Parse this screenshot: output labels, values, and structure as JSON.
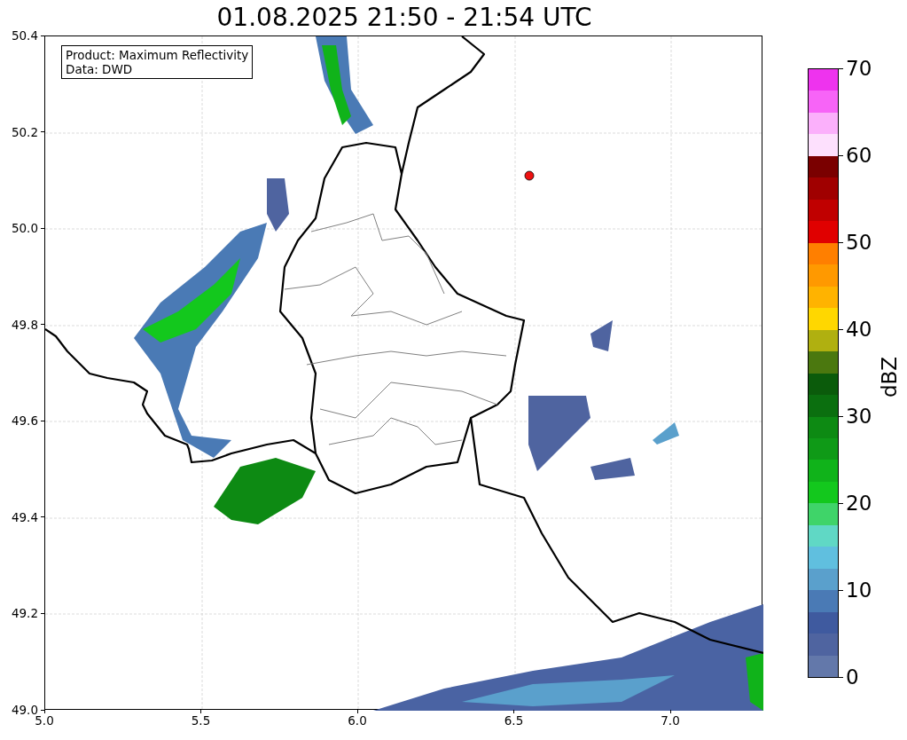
{
  "title": "01.08.2025 21:50 - 21:54 UTC",
  "info_box": [
    "Product: Maximum Reflectivity",
    "Data: DWD"
  ],
  "x_ticks": [
    "5.0",
    "5.5",
    "6.0",
    "6.5",
    "7.0"
  ],
  "y_ticks": [
    "50.4",
    "50.2",
    "50.0",
    "49.8",
    "49.6",
    "49.4",
    "49.2",
    "49.0"
  ],
  "colorbar": {
    "label": "dBZ",
    "ticks": [
      "70",
      "60",
      "50",
      "40",
      "30",
      "20",
      "10",
      "0"
    ],
    "bands": [
      {
        "color": "#ee33ee"
      },
      {
        "color": "#f764f7"
      },
      {
        "color": "#fbb0fb"
      },
      {
        "color": "#fde0fd"
      },
      {
        "color": "#7a0000"
      },
      {
        "color": "#a00000"
      },
      {
        "color": "#c00000"
      },
      {
        "color": "#e00000"
      },
      {
        "color": "#ff7f00"
      },
      {
        "color": "#ff9900"
      },
      {
        "color": "#ffb300"
      },
      {
        "color": "#ffd700"
      },
      {
        "color": "#b0b010"
      },
      {
        "color": "#4b780f"
      },
      {
        "color": "#0b5b0b"
      },
      {
        "color": "#0b6f0f"
      },
      {
        "color": "#0d8a13"
      },
      {
        "color": "#0f9a17"
      },
      {
        "color": "#10b31a"
      },
      {
        "color": "#13c81d"
      },
      {
        "color": "#3fd469"
      },
      {
        "color": "#60d8c5"
      },
      {
        "color": "#60bfdf"
      },
      {
        "color": "#5aa0cc"
      },
      {
        "color": "#4a7ab5"
      },
      {
        "color": "#3f5a9f"
      },
      {
        "color": "#4f64a0"
      },
      {
        "color": "#6378aa"
      }
    ]
  }
}
